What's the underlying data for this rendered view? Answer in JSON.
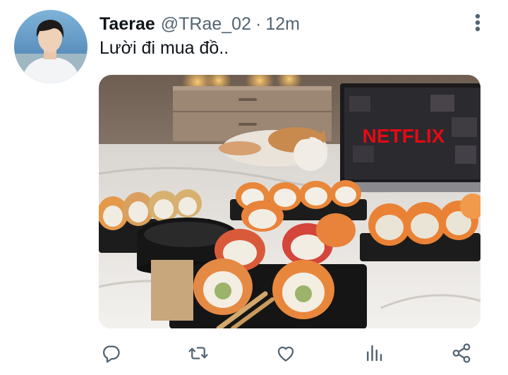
{
  "tweet": {
    "display_name": "Taerae",
    "handle": "@TRae_02",
    "separator": "·",
    "time": "12m",
    "text": "Lười đi mua đồ.."
  },
  "media": {
    "laptop_brand_text": "NETFLIX"
  },
  "actions": {
    "icons": [
      "reply-icon",
      "retweet-icon",
      "like-icon",
      "analytics-icon",
      "share-icon"
    ],
    "icon_color": "#536471"
  },
  "colors": {
    "text_primary": "#0f1419",
    "text_secondary": "#536471",
    "netflix_red": "#e50914"
  }
}
